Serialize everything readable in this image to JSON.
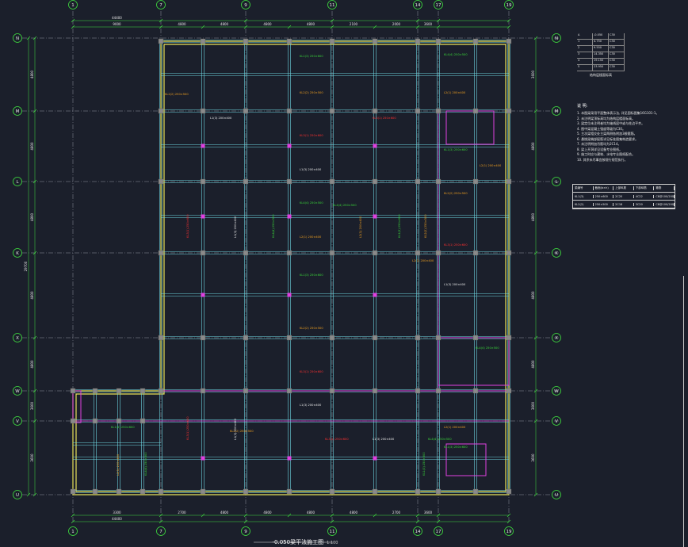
{
  "drawing": {
    "title": "-0.050梁平法施工图",
    "scale": "1:100",
    "colors": {
      "background": "#1b1f2b",
      "beam": "#6fd7e2",
      "beam_edge": "#3fa9b8",
      "wall": "#e8e25a",
      "grid_line": "#b0b4c0",
      "axis_bubble": "#3fe03f",
      "dimension": "#3fe03f",
      "magenta": "#e040e0",
      "label_green": "#39d739",
      "label_orange": "#f0a020",
      "label_red": "#ff3030",
      "label_white": "#e8e8e8",
      "column": "#8a8a8a"
    }
  },
  "axes": {
    "top": [
      "1",
      "7",
      "9",
      "11",
      "14",
      "17",
      "19"
    ],
    "bottom": [
      "1",
      "7",
      "9",
      "11",
      "14",
      "17",
      "19"
    ],
    "left": [
      "N",
      "M",
      "L",
      "K",
      "X",
      "W",
      "V",
      "U"
    ],
    "right": [
      "N",
      "M",
      "L",
      "K",
      "X",
      "W",
      "V",
      "U"
    ]
  },
  "dimensions": {
    "top_total": "44400",
    "bottom_total": "44400",
    "top_segments": [
      "9000",
      "4800",
      "4800",
      "4800",
      "4800",
      "2100",
      "2000",
      "3600"
    ],
    "bottom_segments": [
      "3300",
      "2700",
      "4800",
      "4800",
      "4800",
      "4800",
      "2700",
      "3600"
    ],
    "left_total": "29700",
    "left_segments": [
      "4800",
      "4800",
      "4800",
      "4800",
      "4800",
      "3600",
      "3600"
    ],
    "right_segments": [
      "3600",
      "4800",
      "4800",
      "4800",
      "4800",
      "3600",
      "3600"
    ]
  },
  "legend": {
    "rows": [
      [
        "A",
        "-0.050",
        "C30"
      ],
      [
        "1",
        "4.750",
        "C30"
      ],
      [
        "2",
        "9.550",
        "C30"
      ],
      [
        "3",
        "14.350",
        "C30"
      ],
      [
        "4",
        "19.150",
        "C30"
      ],
      [
        "5",
        "23.950",
        "C30"
      ]
    ],
    "caption": "结构层楼面标高"
  },
  "notes": {
    "title": "说 明:",
    "lines": [
      "1. 本图梁采用平面整体表示法, 详见国标图集16G101-1。",
      "2. 未注明梁顶标高均为结构层楼面标高。",
      "3. 梁定位未注明者均为轴线居中或与柱边平齐。",
      "4. 图中梁混凝土强度等级为C30。",
      "5. 主次梁相交处主梁两侧各附加3根箍筋。",
      "6. 悬挑梁端部配筋详见标准图集构造要求。",
      "7. 未注明附加吊筋均为2C14。",
      "8. 梁上开洞详见设备专业图纸。",
      "9. 施工时应与建筑、水电专业图纸配合。",
      "10. 其余未尽事宜按现行规范执行。"
    ]
  },
  "schedule": {
    "rows": [
      [
        "梁编号",
        "截面(b×h)",
        "上部纵筋",
        "下部纵筋",
        "箍筋"
      ],
      [
        "KL1(3)",
        "250×600",
        "2C20",
        "4C22",
        "C8@100/200"
      ],
      [
        "KL2(2)",
        "250×500",
        "2C18",
        "3C20",
        "C8@100/200"
      ]
    ]
  },
  "beam_labels": [
    {
      "text": "KL1(3) 250×600",
      "color": "green"
    },
    {
      "text": "KL2(2) 250×500",
      "color": "orange"
    },
    {
      "text": "KL3(1) 250×600",
      "color": "red"
    },
    {
      "text": "L1(3) 200×400",
      "color": "white"
    },
    {
      "text": "KL4(4) 250×500",
      "color": "green"
    },
    {
      "text": "L2(1) 200×400",
      "color": "orange"
    }
  ]
}
